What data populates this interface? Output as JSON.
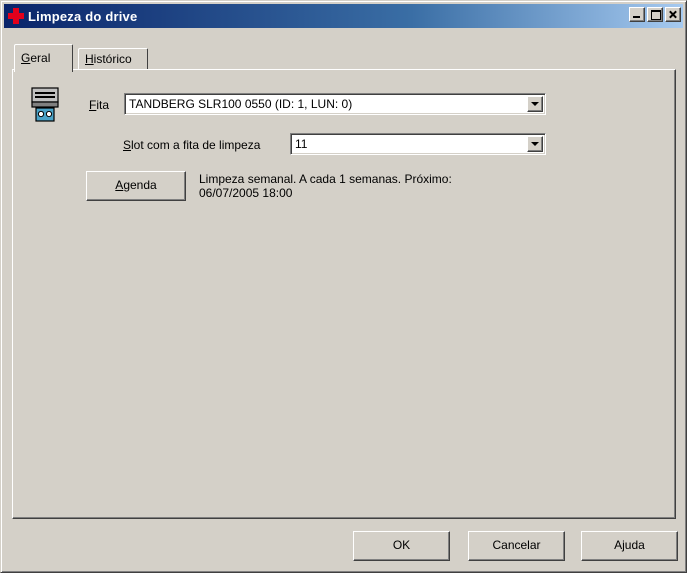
{
  "window": {
    "title": "Limpeza do drive",
    "app_icon": "red-cross-icon"
  },
  "tabs": [
    {
      "label": "Geral",
      "accel": "G",
      "rest": "eral",
      "active": true
    },
    {
      "label": "Histórico",
      "accel": "H",
      "rest": "istórico",
      "active": false
    }
  ],
  "general": {
    "tape_icon": "tape-drive-icon",
    "tape_label_accel": "F",
    "tape_label_rest": "ita",
    "tape_value": "TANDBERG SLR100 0550 (ID: 1, LUN: 0)",
    "slot_label_accel": "S",
    "slot_label_rest": "lot com a fita de limpeza",
    "slot_value": "11",
    "schedule_button_accel": "A",
    "schedule_button_rest": "genda",
    "schedule_line1": "Limpeza semanal. A cada 1 semanas. Próximo:",
    "schedule_line2": "06/07/2005 18:00"
  },
  "footer": {
    "ok": "OK",
    "cancel": "Cancelar",
    "help": "Ajuda"
  }
}
